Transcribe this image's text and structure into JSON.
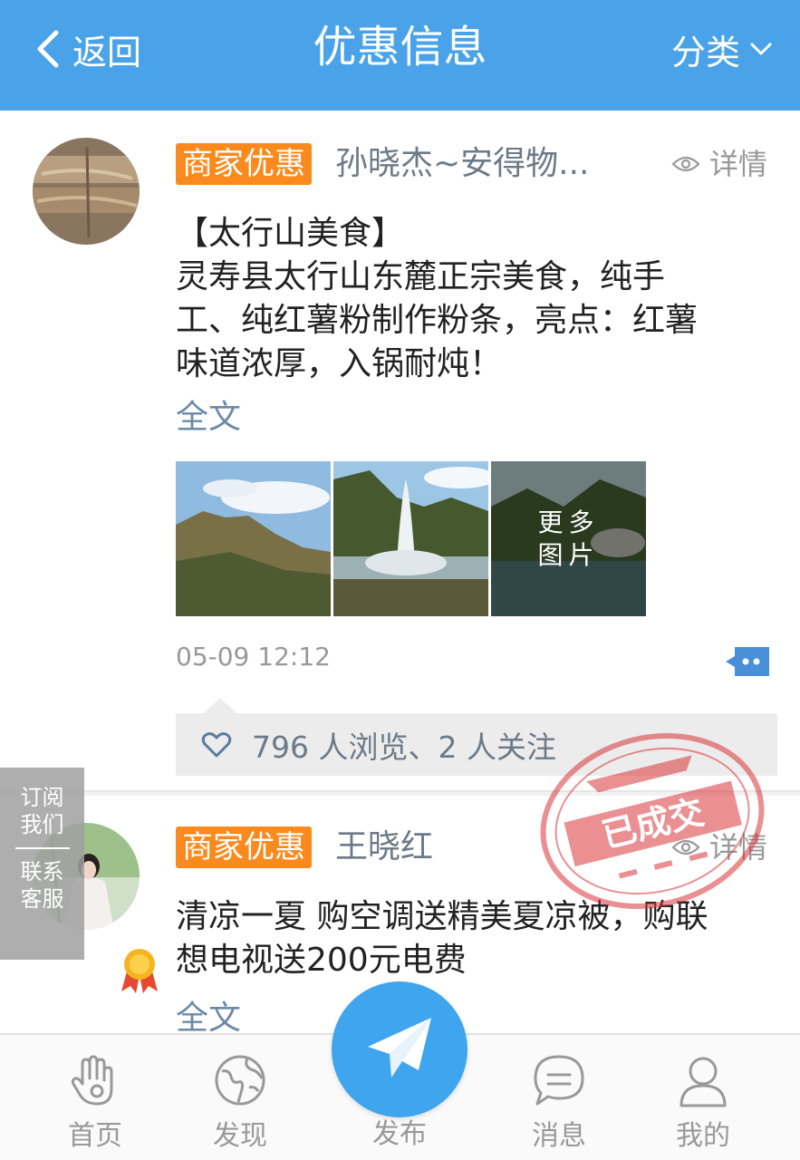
{
  "header": {
    "back_label": "返回",
    "title": "优惠信息",
    "category_label": "分类"
  },
  "posts": [
    {
      "tag": "商家优惠",
      "author": "孙晓杰~安得物...",
      "detail_label": "详情",
      "content_lines": [
        "【太行山美食】",
        "灵寿县太行山东麓正宗美食，纯手",
        "工、纯红薯粉制作粉条，亮点：红薯",
        "味道浓厚，入锅耐炖！"
      ],
      "fulltext_label": "全文",
      "more_photos_line1": "更多",
      "more_photos_line2": "图片",
      "time": "05-09 12:12",
      "stats": "796 人浏览、2 人关注"
    },
    {
      "tag": "商家优惠",
      "author": "王晓红",
      "detail_label": "详情",
      "content_lines": [
        "清凉一夏 购空调送精美夏凉被，购联",
        "想电视送200元电费"
      ],
      "fulltext_label": "全文",
      "stamp_text": "已成交"
    }
  ],
  "subscribe_panel": {
    "line1": "订阅",
    "line2": "我们",
    "line3": "联系",
    "line4": "客服"
  },
  "tabbar": {
    "items": [
      {
        "label": "首页",
        "icon": "palm-hand-icon"
      },
      {
        "label": "发现",
        "icon": "globe-icon"
      },
      {
        "label": "发布",
        "icon": "paper-plane-icon"
      },
      {
        "label": "消息",
        "icon": "chat-bubble-icon"
      },
      {
        "label": "我的",
        "icon": "person-icon"
      }
    ]
  },
  "colors": {
    "header_bg": "#4aa3e8",
    "tag_bg": "#fb8a1e",
    "publish_bg": "#3ea5ee",
    "stamp_red": "#d9343a"
  }
}
